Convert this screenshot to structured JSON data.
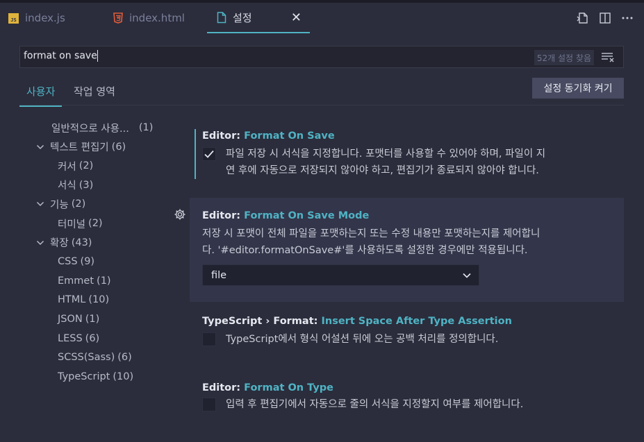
{
  "tabs": [
    {
      "label": "index.js",
      "icon": "js-file-icon"
    },
    {
      "label": "index.html",
      "icon": "html5-file-icon"
    },
    {
      "label": "설정",
      "icon": "file-icon",
      "active": true
    }
  ],
  "close_glyph": "✕",
  "search": {
    "value": "format on save",
    "result_count": "52개 설정 찾음"
  },
  "scope_tabs": {
    "user": "사용자",
    "workspace": "작업 영역"
  },
  "sync_button": "설정 동기화 켜기",
  "toc": [
    {
      "label": "일반적으로 사용...",
      "count": "(1)",
      "indent": 1,
      "expandable": false
    },
    {
      "label": "텍스트 편집기",
      "count": "(6)",
      "indent": 0,
      "expandable": true
    },
    {
      "label": "커서",
      "count": "(2)",
      "indent": 2,
      "expandable": false
    },
    {
      "label": "서식",
      "count": "(3)",
      "indent": 2,
      "expandable": false
    },
    {
      "label": "기능",
      "count": "(2)",
      "indent": 0,
      "expandable": true
    },
    {
      "label": "터미널",
      "count": "(2)",
      "indent": 2,
      "expandable": false
    },
    {
      "label": "확장",
      "count": "(43)",
      "indent": 0,
      "expandable": true
    },
    {
      "label": "CSS",
      "count": "(9)",
      "indent": 2,
      "expandable": false
    },
    {
      "label": "Emmet",
      "count": "(1)",
      "indent": 2,
      "expandable": false
    },
    {
      "label": "HTML",
      "count": "(10)",
      "indent": 2,
      "expandable": false
    },
    {
      "label": "JSON",
      "count": "(1)",
      "indent": 2,
      "expandable": false
    },
    {
      "label": "LESS",
      "count": "(6)",
      "indent": 2,
      "expandable": false
    },
    {
      "label": "SCSS(Sass)",
      "count": "(6)",
      "indent": 2,
      "expandable": false
    },
    {
      "label": "TypeScript",
      "count": "(10)",
      "indent": 2,
      "expandable": false
    }
  ],
  "settings": {
    "format_on_save": {
      "category": "Editor: ",
      "key": "Format On Save",
      "description_line1": "파일 저장 시 서식을 지정합니다. 포맷터를 사용할 수 있어야 하며, 파일이 지",
      "description_line2": "연 후에 자동으로 저장되지 않아야 하고, 편집기가 종료되지 않아야 합니다.",
      "checked": true
    },
    "format_on_save_mode": {
      "category": "Editor: ",
      "key": "Format On Save Mode",
      "description_line1": "저장 시 포맷이 전체 파일을 포맷하는지 또는 수정 내용만 포맷하는지를 제어합니",
      "description_line2": "다. '#editor.formatOnSave#'를 사용하도록 설정한 경우에만 적용됩니다.",
      "value": "file"
    },
    "ts_insert_space": {
      "category": "TypeScript › Format: ",
      "key": "Insert Space After Type Assertion",
      "description": "TypeScript에서 형식 어설션 뒤에 오는 공백 처리를 정의합니다.",
      "checked": false
    },
    "format_on_type": {
      "category": "Editor: ",
      "key": "Format On Type",
      "description": "입력 후 편집기에서 자동으로 줄의 서식을 지정할지 여부를 제어합니다.",
      "checked": false
    }
  },
  "colors": {
    "accent": "#4fb3c4",
    "background": "#2b2d3c",
    "highlight": "#33354a"
  }
}
